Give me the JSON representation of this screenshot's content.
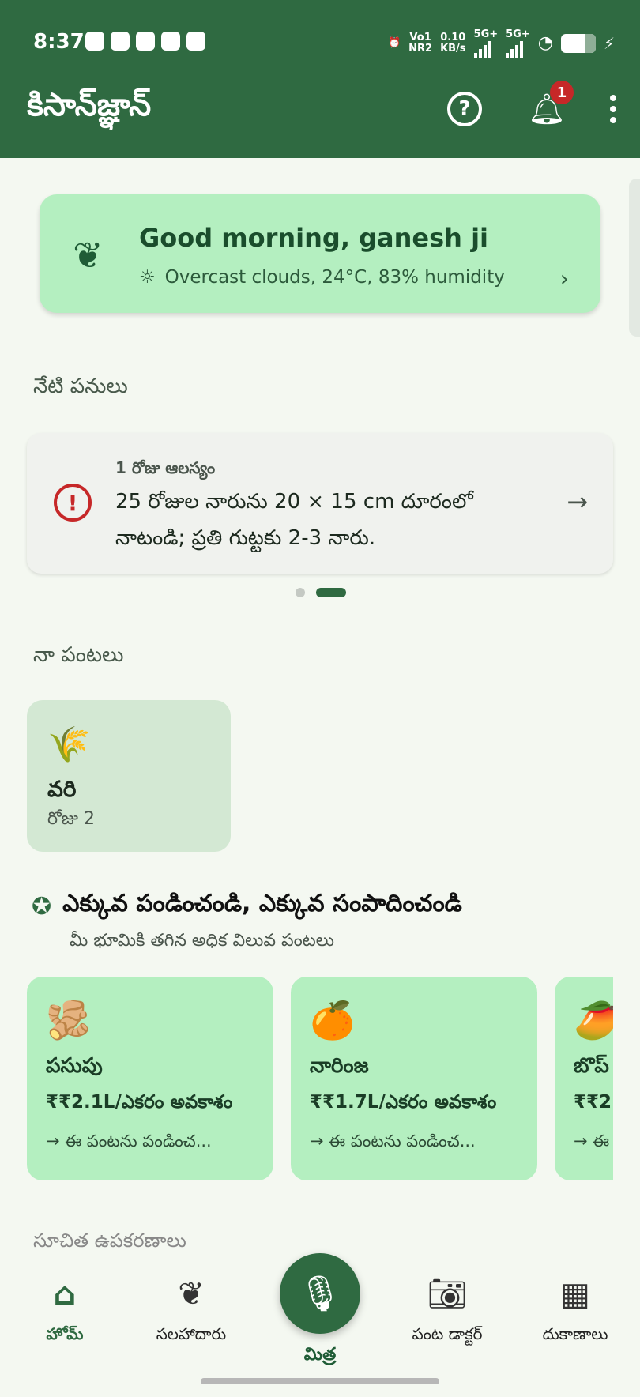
{
  "status_bar": {
    "time": "8:37",
    "net_top": "Vo1",
    "net_bottom": "NR2",
    "speed_top": "0.10",
    "speed_bottom": "KB/s",
    "sig1": "5G+",
    "sig2": "5G+"
  },
  "app_bar": {
    "title": "కిసాన్‌జ్ఞాన్",
    "notification_count": "1"
  },
  "greeting": {
    "title": "Good morning, ganesh ji",
    "weather": "Overcast clouds, 24°C, 83% humidity"
  },
  "tasks": {
    "section_title": "నేటి పనులు",
    "delay": "1 రోజు ఆలస్యం",
    "text": "25 రోజుల నారును 20 × 15 cm దూరంలో నాటండి; ప్రతి గుట్టకు 2-3 నారు."
  },
  "my_crops": {
    "section_title": "నా పంటలు",
    "items": [
      {
        "icon": "rice-emoji",
        "emoji": "🌾",
        "name": "వరి",
        "day": "రోజు 2"
      }
    ]
  },
  "earn_more": {
    "title": "ఎక్కువ పండించండి, ఎక్కువ సంపాదించండి",
    "subtitle": "మీ భూమికి తగిన అధిక విలువ పంటలు",
    "cards": [
      {
        "emoji": "🫚",
        "name": "పసుపు",
        "value": "₹₹2.1L/ఎకరం అవకాశం",
        "cta": "→ ఈ పంటను పండించ..."
      },
      {
        "emoji": "🍊",
        "name": "నారింజ",
        "value": "₹₹1.7L/ఎకరం అవకాశం",
        "cta": "→ ఈ పంటను పండించ..."
      },
      {
        "emoji": "🥭",
        "name": "బొప్",
        "value": "₹₹2.",
        "cta": "→ ఈ"
      }
    ]
  },
  "partial_section": "సూచిత ఉపకరణాలు",
  "bottom_nav": {
    "home": "హోమ్",
    "advisor": "సలహాదారు",
    "mitra": "మిత్ర",
    "crop_doctor": "పంట డాక్టర్",
    "shops": "దుకాణాలు"
  },
  "colors": {
    "primary": "#2f6a41",
    "card_green": "#b4efc0",
    "alert_red": "#c62828"
  }
}
